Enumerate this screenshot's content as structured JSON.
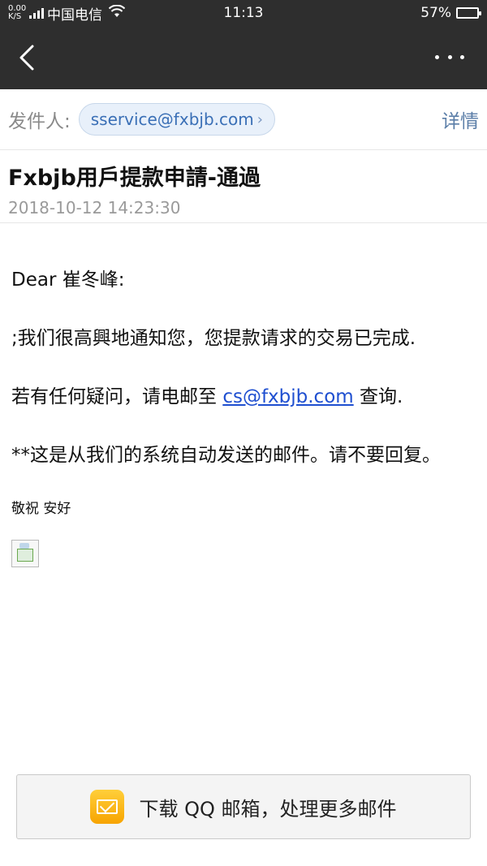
{
  "status_bar": {
    "speed": "0.00 K/S",
    "carrier": "中国电信",
    "time": "11:13",
    "battery": "57%",
    "battery_level": 0.57
  },
  "nav": {
    "back_icon": "chevron-left-icon",
    "more_icon": "more-dots-icon"
  },
  "sender": {
    "label": "发件人:",
    "email": "sservice@fxbjb.com",
    "details_label": "详情"
  },
  "subject": {
    "title": "Fxbjb用戶提款申請-通過",
    "datetime": "2018-10-12 14:23:30"
  },
  "body": {
    "greeting": "Dear 崔冬峰:",
    "para1": " ;我们很高興地通知您，您提款请求的交易已完成.",
    "para2_prefix": "若有任何疑问，请电邮至 ",
    "para2_link": "cs@fxbjb.com",
    "para2_suffix": " 查询.",
    "para3": "**这是从我们的系统自动发送的邮件。请不要回复。",
    "sign": "敬祝 安好"
  },
  "banner": {
    "label": "下载 QQ 邮箱，处理更多邮件"
  },
  "colors": {
    "topbar": "#2e2e2e",
    "chip_bg": "#e8f0fa",
    "chip_text": "#3a6fb6",
    "link": "#1f4fd0",
    "qq_yellow": "#fcb800"
  }
}
